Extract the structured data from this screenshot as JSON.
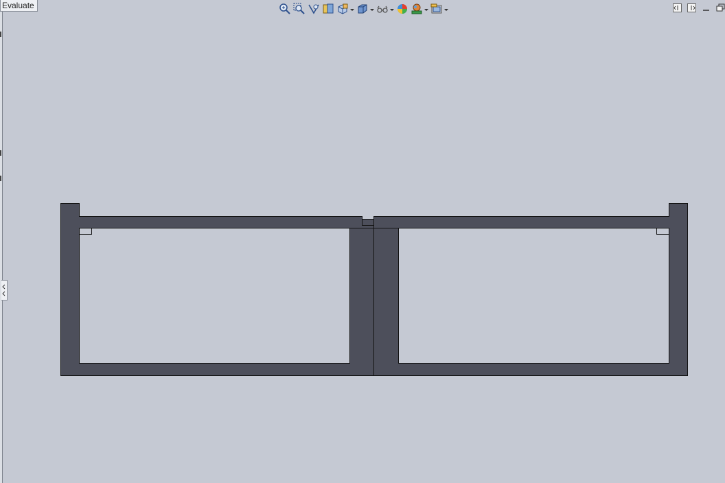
{
  "tabs": {
    "evaluate_label": "Evaluate"
  },
  "heads_up_toolbar": {
    "tools": [
      {
        "icon": "zoom-to-fit-icon"
      },
      {
        "icon": "zoom-to-area-icon"
      },
      {
        "icon": "previous-view-icon"
      },
      {
        "icon": "section-view-icon"
      },
      {
        "icon": "view-orientation-icon",
        "dropdown": true
      },
      {
        "icon": "display-style-icon",
        "dropdown": true
      },
      {
        "icon": "hide-show-items-icon",
        "dropdown": true
      },
      {
        "icon": "edit-appearance-icon"
      },
      {
        "icon": "apply-scene-icon",
        "dropdown": true
      },
      {
        "icon": "view-settings-icon",
        "dropdown": true
      }
    ]
  },
  "window_controls": [
    "tile-horizontal-icon",
    "tile-vertical-icon",
    "minimize-icon",
    "restore-icon"
  ],
  "colors": {
    "background": "#c5c9d3",
    "section_fill": "#4d4f5b",
    "edge": "#111111"
  }
}
